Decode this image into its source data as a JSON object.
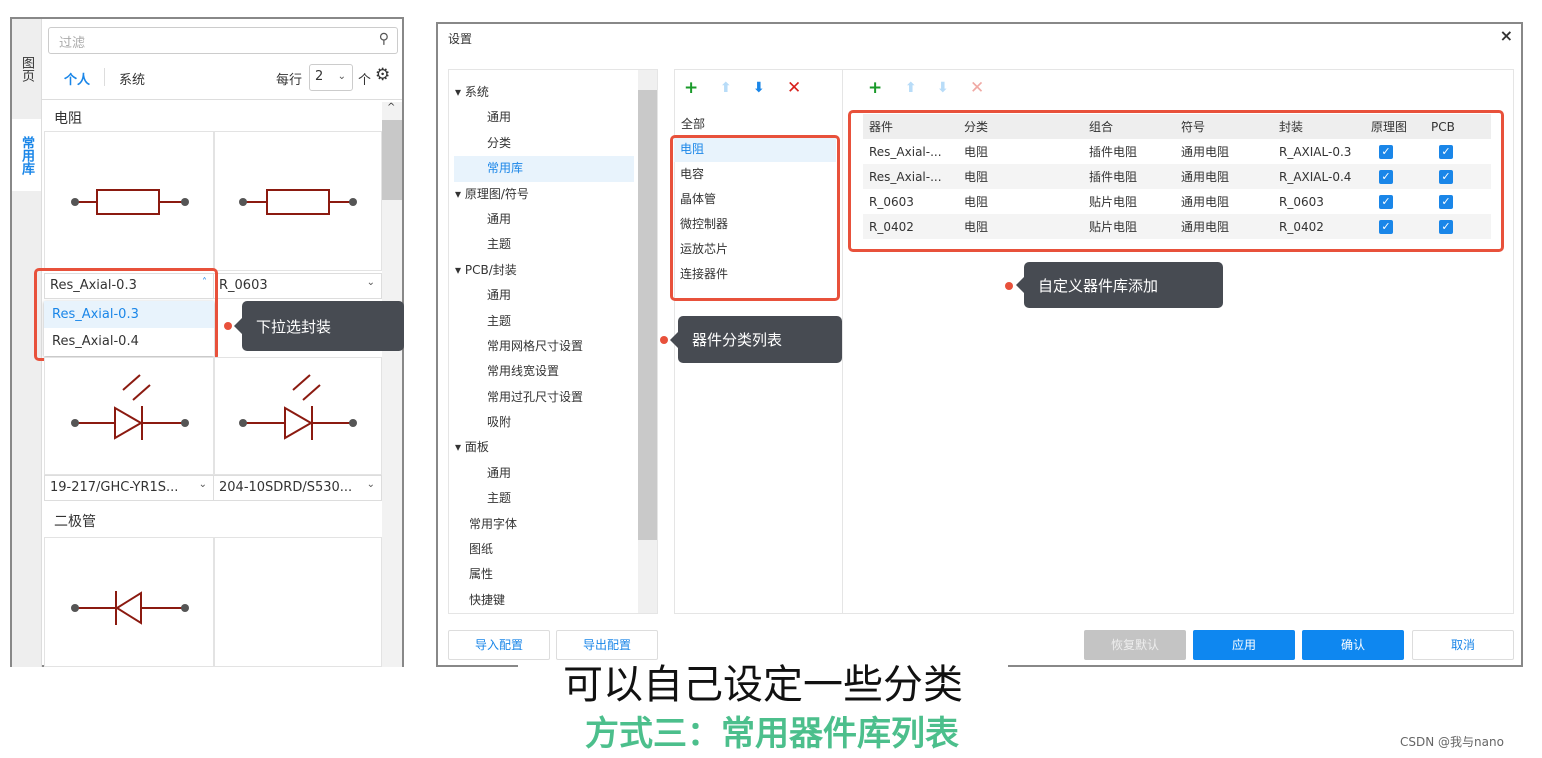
{
  "library_panel": {
    "side_tabs": [
      "图页",
      "常用库"
    ],
    "filter_placeholder": "过滤",
    "tabs": [
      "个人",
      "系统"
    ],
    "per_row_label": "每行",
    "per_row_value": "2",
    "per_row_unit": "个",
    "sections": [
      {
        "title": "电阻"
      },
      {
        "title": "二极管"
      }
    ],
    "cells": [
      "Res_Axial-0.3",
      "R_0603",
      "19-217/GHC-YR1S...",
      "204-10SDRD/S530..."
    ],
    "dropdown_options": [
      "Res_Axial-0.3",
      "Res_Axial-0.4"
    ],
    "tooltip": "下拉选封装"
  },
  "dialog": {
    "title": "设置",
    "tree": [
      {
        "label": "系统",
        "level": 0
      },
      {
        "label": "通用",
        "level": 1
      },
      {
        "label": "分类",
        "level": 1
      },
      {
        "label": "常用库",
        "level": 1,
        "selected": true
      },
      {
        "label": "原理图/符号",
        "level": 0
      },
      {
        "label": "通用",
        "level": 1
      },
      {
        "label": "主题",
        "level": 1
      },
      {
        "label": "PCB/封装",
        "level": 0
      },
      {
        "label": "通用",
        "level": 1
      },
      {
        "label": "主题",
        "level": 1
      },
      {
        "label": "常用网格尺寸设置",
        "level": 1
      },
      {
        "label": "常用线宽设置",
        "level": 1
      },
      {
        "label": "常用过孔尺寸设置",
        "level": 1
      },
      {
        "label": "吸附",
        "level": 1
      },
      {
        "label": "面板",
        "level": 0
      },
      {
        "label": "通用",
        "level": 1
      },
      {
        "label": "主题",
        "level": 1
      },
      {
        "label": "常用字体",
        "level": 0.5
      },
      {
        "label": "图纸",
        "level": 0.5
      },
      {
        "label": "属性",
        "level": 0.5
      },
      {
        "label": "快捷键",
        "level": 0.5
      }
    ],
    "categories_all": "全部",
    "categories": [
      "电阻",
      "电容",
      "晶体管",
      "微控制器",
      "运放芯片",
      "连接器件"
    ],
    "categories_tooltip": "器件分类列表",
    "table_columns": [
      "器件",
      "分类",
      "组合",
      "符号",
      "封装",
      "原理图",
      "PCB"
    ],
    "table_rows": [
      [
        "Res_Axial-...",
        "电阻",
        "插件电阻",
        "通用电阻",
        "R_AXIAL-0.3",
        true,
        true
      ],
      [
        "Res_Axial-...",
        "电阻",
        "插件电阻",
        "通用电阻",
        "R_AXIAL-0.4",
        true,
        true
      ],
      [
        "R_0603",
        "电阻",
        "贴片电阻",
        "通用电阻",
        "R_0603",
        true,
        true
      ],
      [
        "R_0402",
        "电阻",
        "贴片电阻",
        "通用电阻",
        "R_0402",
        true,
        true
      ]
    ],
    "table_tooltip": "自定义器件库添加",
    "buttons": {
      "import": "导入配置",
      "export": "导出配置",
      "reset": "恢复默认",
      "apply": "应用",
      "ok": "确认",
      "cancel": "取消"
    }
  },
  "caption": "可以自己设定一些分类",
  "subtitle": "方式三：常用器件库列表",
  "watermark": "CSDN @我与nano",
  "colors": {
    "accent": "#1a86e8",
    "highlight": "#e8513b",
    "subtitle": "#4cbf8c"
  }
}
